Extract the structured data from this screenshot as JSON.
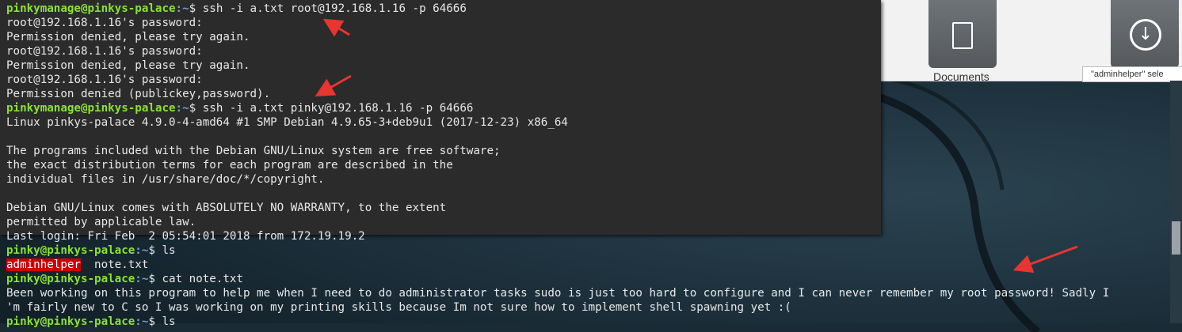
{
  "file_manager": {
    "folders": [
      {
        "label": "Documents",
        "icon": "document-icon"
      },
      {
        "label": "",
        "icon": "download-icon"
      }
    ],
    "tooltip": "\"adminhelper\" sele"
  },
  "terminal": {
    "prompt_ssh_host": {
      "user_host": "pinkymanage@pinkys-palace",
      "path": ":~",
      "sign": "$ "
    },
    "prompt_target": {
      "user_host": "pinky@pinkys-palace",
      "path": ":~",
      "sign": "$ "
    },
    "commands": [
      "ssh -i a.txt root@192.168.1.16 -p 64666",
      "ssh -i a.txt pinky@192.168.1.16 -p 64666",
      "ls",
      "cat note.txt",
      "ls"
    ],
    "outputs": {
      "pw_prompt": "root@192.168.1.16's password:",
      "denied_retry": "Permission denied, please try again.",
      "denied_final": "Permission denied (publickey,password).",
      "uname": "Linux pinkys-palace 4.9.0-4-amd64 #1 SMP Debian 4.9.65-3+deb9u1 (2017-12-23) x86_64",
      "motd1": "The programs included with the Debian GNU/Linux system are free software;",
      "motd2": "the exact distribution terms for each program are described in the",
      "motd3": "individual files in /usr/share/doc/*/copyright.",
      "motd4": "Debian GNU/Linux comes with ABSOLUTELY NO WARRANTY, to the extent",
      "motd5": "permitted by applicable law.",
      "last_login": "Last login: Fri Feb  2 05:54:01 2018 from 172.19.19.2",
      "ls_dir": "adminhelper",
      "ls_file": "  note.txt",
      "note1": "Been working on this program to help me when I need to do administrator tasks sudo is just too hard to configure and I can never remember my root password! Sadly I",
      "note2": "'m fairly new to C so I was working on my printing skills because Im not sure how to implement shell spawning yet :("
    }
  },
  "colors": {
    "prompt_user": "#8ae234",
    "prompt_path": "#729fcf",
    "directory_bg": "#cc0000",
    "annotation_arrow": "#e8352f"
  }
}
